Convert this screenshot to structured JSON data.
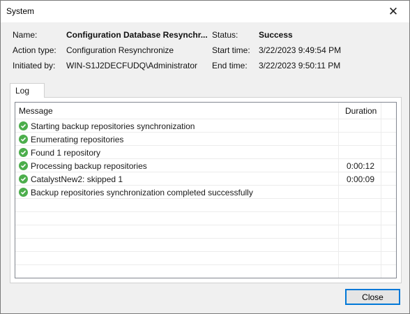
{
  "window": {
    "title": "System"
  },
  "info": {
    "name_label": "Name:",
    "name_value": "Configuration Database Resynchr...",
    "action_type_label": "Action type:",
    "action_type_value": "Configuration Resynchronize",
    "initiated_by_label": "Initiated by:",
    "initiated_by_value": "WIN-S1J2DECFUDQ\\Administrator",
    "status_label": "Status:",
    "status_value": "Success",
    "start_time_label": "Start time:",
    "start_time_value": "3/22/2023 9:49:54 PM",
    "end_time_label": "End time:",
    "end_time_value": "3/22/2023 9:50:11 PM"
  },
  "tabs": [
    {
      "label": "Log"
    }
  ],
  "log": {
    "columns": {
      "message": "Message",
      "duration": "Duration"
    },
    "rows": [
      {
        "message": "Starting backup repositories synchronization",
        "duration": ""
      },
      {
        "message": "Enumerating repositories",
        "duration": ""
      },
      {
        "message": "Found 1 repository",
        "duration": ""
      },
      {
        "message": "Processing backup repositories",
        "duration": "0:00:12"
      },
      {
        "message": "CatalystNew2: skipped 1",
        "duration": "0:00:09"
      },
      {
        "message": "Backup repositories synchronization completed successfully",
        "duration": ""
      }
    ]
  },
  "buttons": {
    "close": "Close"
  },
  "colors": {
    "success_icon": "#4cae4c",
    "focus_border": "#0078d7"
  }
}
